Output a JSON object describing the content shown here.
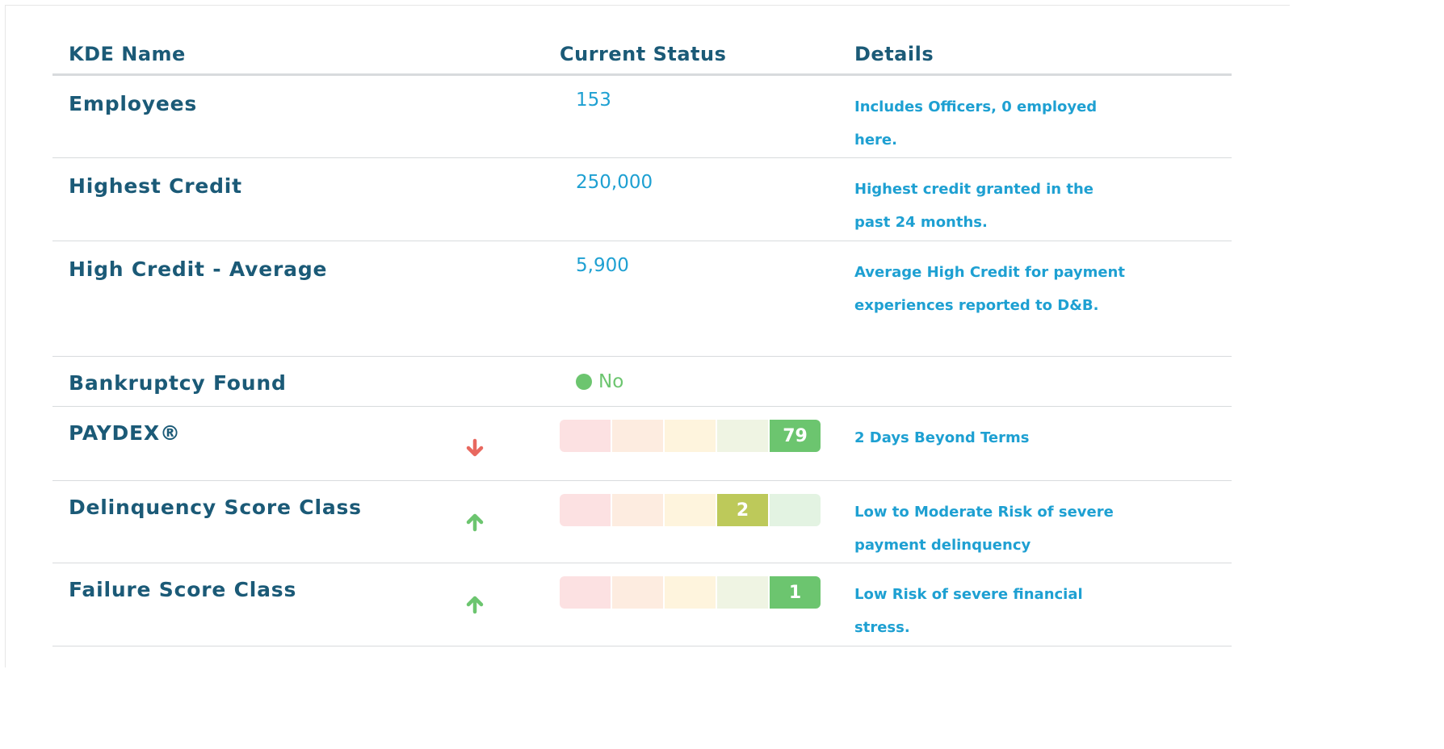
{
  "header": {
    "col1": "KDE Name",
    "col2": "Current Status",
    "col3": "Details"
  },
  "rows": {
    "employees": {
      "name": "Employees",
      "value": "153",
      "details": "Includes Officers, 0 employed here."
    },
    "highest_credit": {
      "name": "Highest Credit",
      "value": "250,000",
      "details": "Highest credit granted in the past 24 months."
    },
    "high_credit_avg": {
      "name": "High Credit - Average",
      "value": "5,900",
      "details": "Average High Credit for payment experiences reported to D&B."
    },
    "bankruptcy": {
      "name": "Bankruptcy Found",
      "value": "No",
      "status_color": "#6cc56f"
    },
    "paydex": {
      "name": "PAYDEX®",
      "score": "79",
      "active_segment": 5,
      "trend": "down",
      "trend_icon": "arrow-down-icon",
      "details": "2 Days Beyond Terms"
    },
    "delinquency": {
      "name": "Delinquency Score Class",
      "score": "2",
      "active_segment": 4,
      "trend": "up",
      "trend_icon": "arrow-up-icon",
      "details": "Low to Moderate Risk of severe payment delinquency"
    },
    "failure": {
      "name": "Failure Score Class",
      "score": "1",
      "active_segment": 5,
      "trend": "up",
      "trend_icon": "arrow-up-icon",
      "details": "Low Risk of severe financial stress."
    }
  },
  "colors": {
    "header_text": "#1b5a77",
    "value_text": "#1ea0d2",
    "trend_down": "#e8685f",
    "trend_up": "#6cc56f",
    "bar_inactive": [
      "#fce1e2",
      "#fdece0",
      "#fef4dd",
      "#eff4e3",
      "#e3f3e2"
    ],
    "bar_active_green": "#6cc56f",
    "bar_active_olive": "#bdc95a"
  }
}
